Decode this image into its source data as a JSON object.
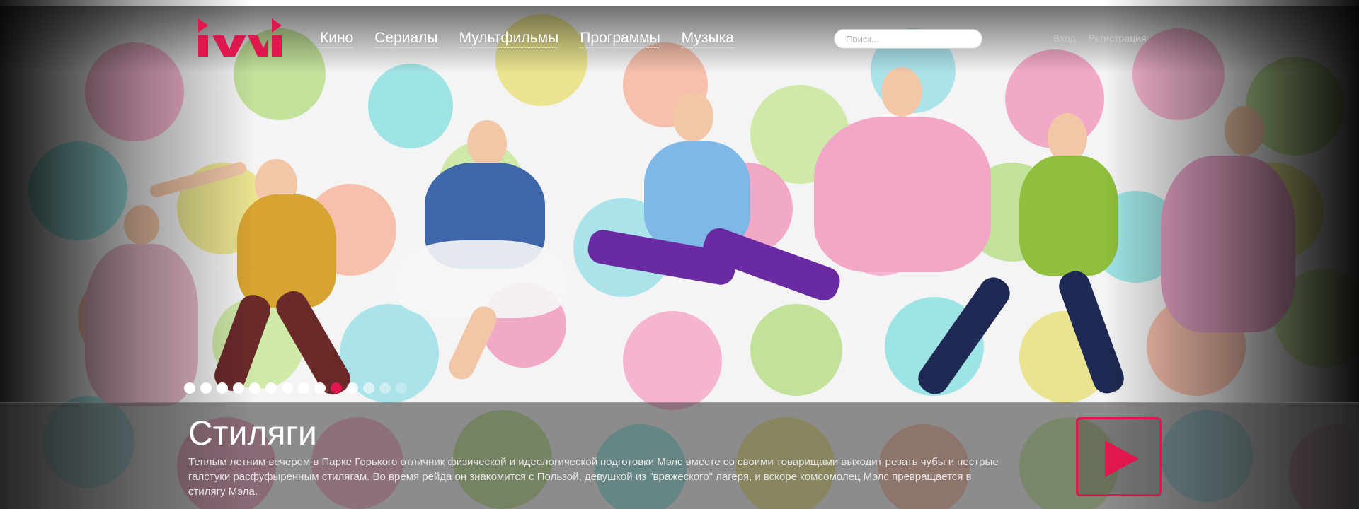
{
  "header": {
    "logo_text": "ivi",
    "nav": [
      "Кино",
      "Сериалы",
      "Мультфильмы",
      "Программы",
      "Музыка"
    ],
    "search_placeholder": "Поиск...",
    "login": "Вход",
    "register": "Регистрация"
  },
  "carousel": {
    "total": 14,
    "active_index": 9
  },
  "feature": {
    "title": "Стиляги",
    "description": "Теплым летним вечером в Парке Горького отличник физической и идеологической подготовки Мэлс вместе со своими товарищами выходит резать чубы и пестрые галстуки расфуфыренным стилягам. Во время рейда он знакомится с Пользой, девушкой из \"вражеского\" лагеря, и вскоре комсомолец Мэлс превращается в стилягу Мэла.",
    "play_icon": "play-icon"
  },
  "colors": {
    "accent": "#e0164e"
  }
}
